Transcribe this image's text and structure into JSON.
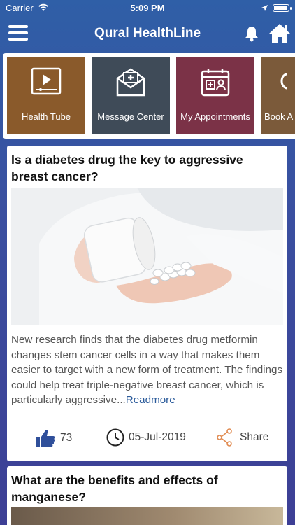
{
  "status_bar": {
    "carrier": "Carrier",
    "time": "5:09 PM"
  },
  "app": {
    "title": "Qural HealthLine"
  },
  "tiles": [
    {
      "label": "Health Tube",
      "icon": "video-player-icon",
      "color": "#8a5a2b"
    },
    {
      "label": "Message Center",
      "icon": "envelope-icon",
      "color": "#3f4b58"
    },
    {
      "label": "My Appointments",
      "icon": "calendar-icon",
      "color": "#7b3247"
    },
    {
      "label": "Book A",
      "icon": "book-icon",
      "color": "#7b5a3a"
    }
  ],
  "articles": [
    {
      "title": "Is a diabetes drug the key to aggressive breast cancer?",
      "image_icon": "pills-in-hand-image",
      "description": "New research finds that the diabetes drug metformin changes stem cancer cells in a way that makes them easier to target with a new form of treatment. The findings could help treat triple-negative breast cancer, which is particularly aggressive...",
      "readmore": "Readmore",
      "likes": "73",
      "date": "05-Jul-2019",
      "share": "Share"
    },
    {
      "title": "What are the benefits and effects of manganese?"
    }
  ]
}
